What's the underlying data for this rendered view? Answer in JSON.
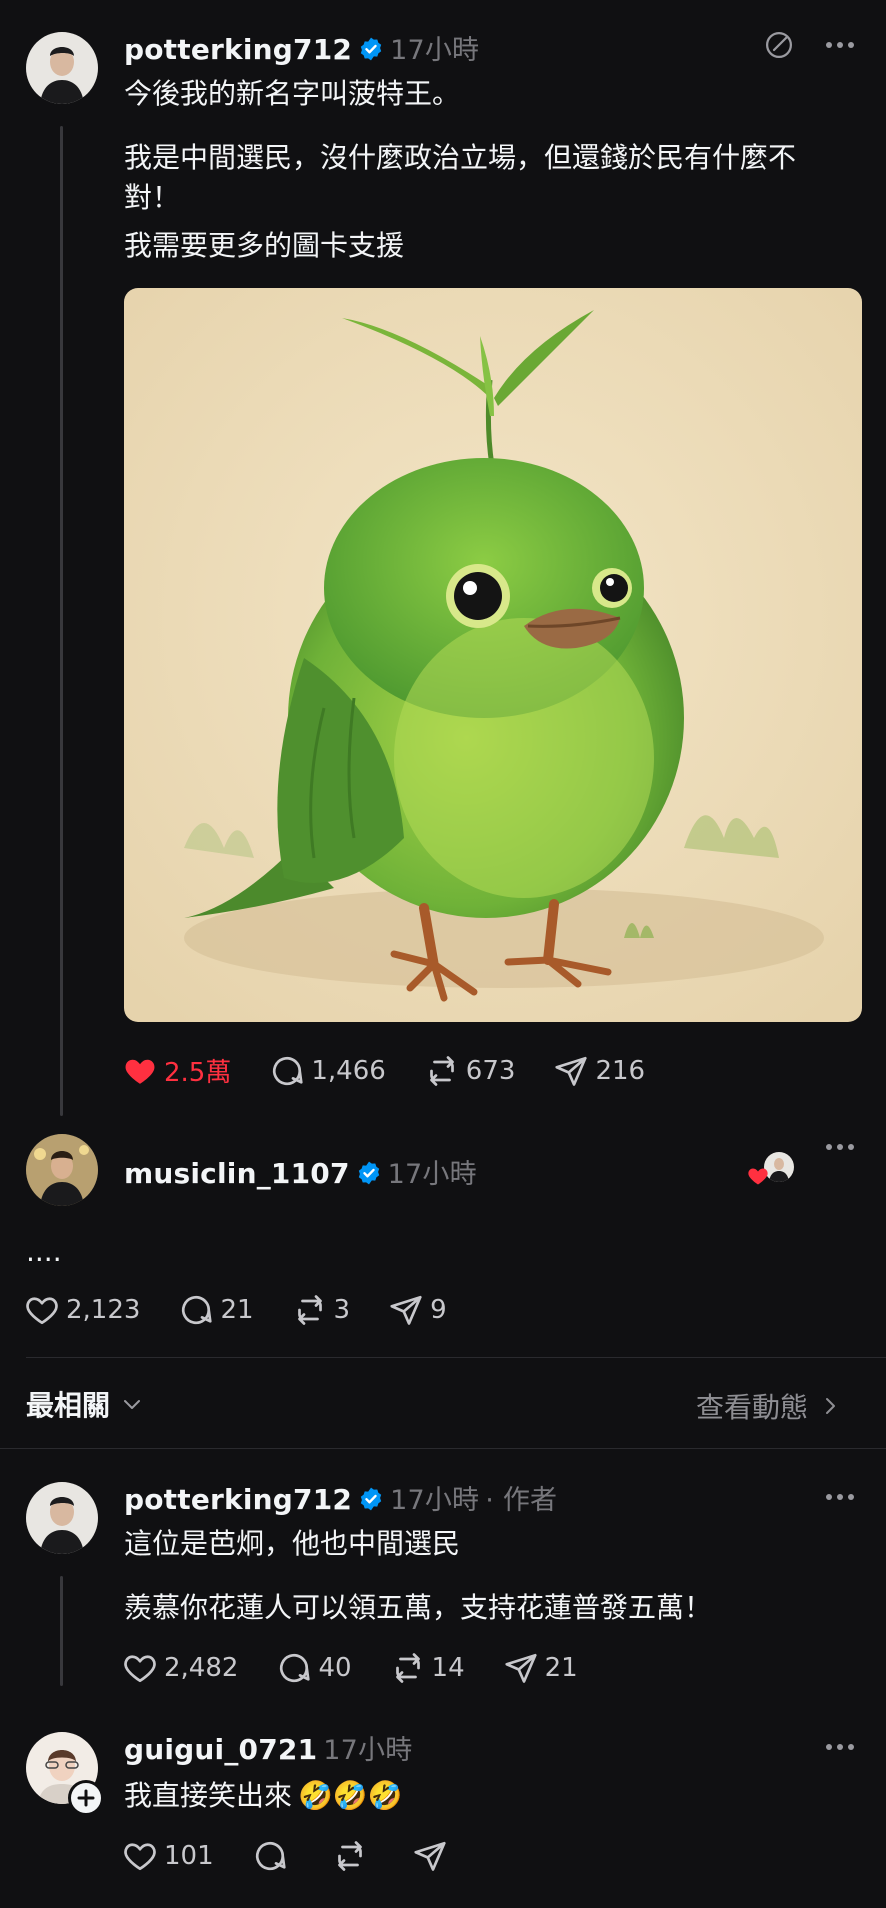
{
  "post": {
    "username": "potterking712",
    "time": "17小時",
    "line1": "今後我的新名字叫菠特王。",
    "line2": "我是中間選民，沒什麼政治立場，但還錢於民有什麼不",
    "line3": "對！",
    "line4": "我需要更多的圖卡支援",
    "image_alt": "green-bird-illustration",
    "likes": "2.5萬",
    "comments": "1,466",
    "reposts": "673",
    "shares": "216",
    "liked": true
  },
  "reply1": {
    "username": "musiclin_1107",
    "time": "17小時",
    "text": "....",
    "likes": "2,123",
    "comments": "21",
    "reposts": "3",
    "shares": "9"
  },
  "sort": {
    "label": "最相關",
    "view_activity": "查看動態"
  },
  "reply2": {
    "username": "potterking712",
    "time": "17小時",
    "author_tag": "· 作者",
    "line1": "這位是芭炯，他也中間選民",
    "line2": "羨慕你花蓮人可以領五萬，支持花蓮普發五萬！",
    "likes": "2,482",
    "comments": "40",
    "reposts": "14",
    "shares": "21"
  },
  "reply3": {
    "username": "guigui_0721",
    "time": "17小時",
    "text": "我直接笑出來",
    "emoji": "🤣🤣🤣",
    "likes": "101"
  },
  "colors": {
    "background": "#101012",
    "like_red": "#ff3040",
    "verified_blue": "#0095f6",
    "muted": "#77777c"
  }
}
